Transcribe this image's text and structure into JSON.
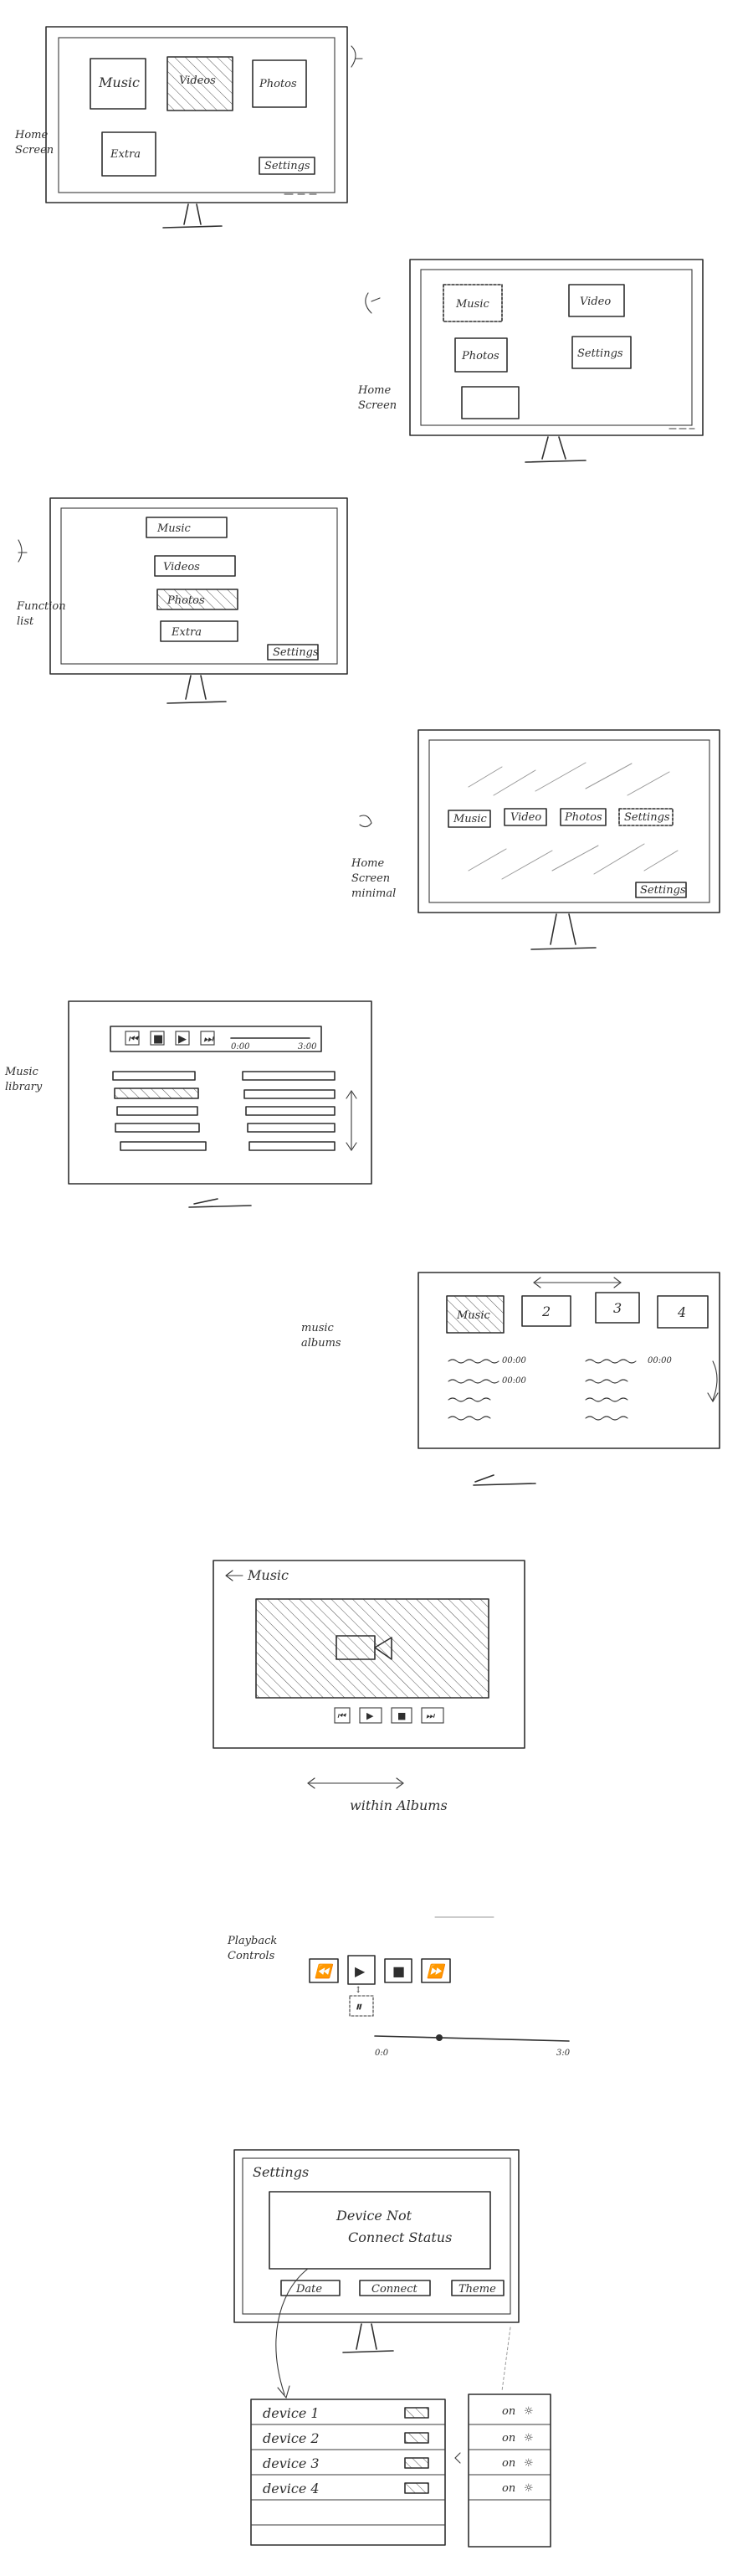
{
  "sketch_1": {
    "side_note_1": "Home",
    "side_note_2": "Screen",
    "tiles": [
      "Music",
      "Videos",
      "Photos",
      "Extra"
    ],
    "settings_button": "Settings"
  },
  "sketch_2": {
    "side_note_1": "Home",
    "side_note_2": "Screen",
    "tiles": [
      "Music",
      "Video",
      "Photos",
      "Settings"
    ]
  },
  "sketch_3": {
    "side_note_1": "Function",
    "side_note_2": "list",
    "items": [
      "Music",
      "Videos",
      "Photos",
      "Extra"
    ],
    "settings_button": "Settings"
  },
  "sketch_4": {
    "side_note_1": "Home",
    "side_note_2": "Screen",
    "side_note_3": "minimal",
    "tabs": [
      "Music",
      "Video",
      "Photos",
      "Settings"
    ],
    "settings_button": "Settings"
  },
  "sketch_5": {
    "side_note_1": "Music",
    "side_note_2": "library",
    "time_start": "0:00",
    "time_end": "3:00"
  },
  "sketch_6": {
    "side_note_1": "music",
    "side_note_2": "albums",
    "album_tiles": [
      "Music",
      "2",
      "3",
      "4"
    ],
    "track_times_left": [
      "00:00",
      "00:00"
    ],
    "track_times_right": [
      "00:00"
    ]
  },
  "sketch_7": {
    "back_label": "Music",
    "caption": "within Albums"
  },
  "sketch_8": {
    "side_note_1": "Playback",
    "side_note_2": "Controls",
    "time_start": "0:0",
    "time_end": "3:0"
  },
  "sketch_9": {
    "title": "Settings",
    "panel_line_1": "Device Not",
    "panel_line_2": "Connect Status",
    "buttons": [
      "Date",
      "Connect",
      "Theme"
    ],
    "devices": [
      "device 1",
      "device 2",
      "device 3",
      "device 4"
    ],
    "toggles": [
      "on",
      "on",
      "on",
      "on"
    ]
  }
}
